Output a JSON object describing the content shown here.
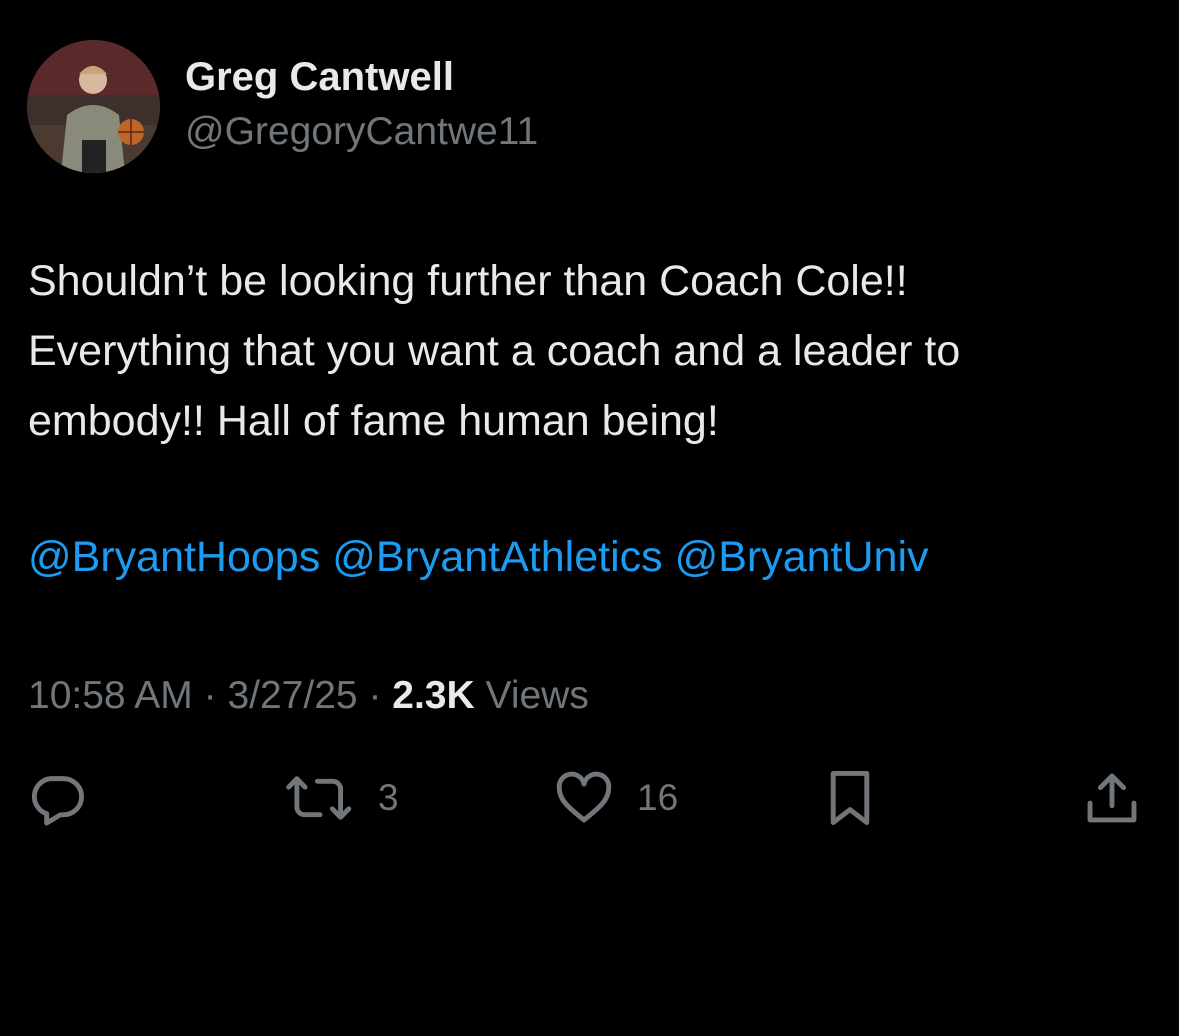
{
  "author": {
    "name": "Greg Cantwell",
    "handle": "@GregoryCantwe11"
  },
  "tweet": {
    "lines": [
      "Shouldn’t be looking further than Coach Cole!!",
      "Everything that you want a coach and a leader to",
      "embody!! Hall of fame human being!"
    ],
    "mentions": [
      "@BryantHoops",
      "@BryantAthletics",
      "@BryantUniv"
    ]
  },
  "meta": {
    "time": "10:58 AM",
    "separator": "·",
    "date": "3/27/25",
    "views_count": "2.3K",
    "views_label": "Views"
  },
  "actions": {
    "reply": {
      "icon": "reply-icon"
    },
    "retweet": {
      "icon": "retweet-icon",
      "count": "3"
    },
    "like": {
      "icon": "heart-icon",
      "count": "16"
    },
    "bookmark": {
      "icon": "bookmark-icon"
    },
    "share": {
      "icon": "share-icon"
    }
  },
  "colors": {
    "background": "#000000",
    "text": "#e7e9ea",
    "secondary": "#71767b",
    "link": "#1d9bf0"
  }
}
